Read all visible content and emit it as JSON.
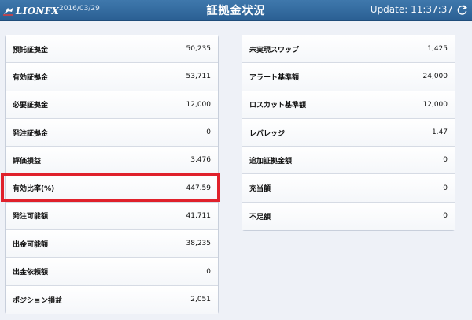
{
  "header": {
    "logo_text": "LIONFX",
    "date": "2016/03/29",
    "title": "証拠金状況",
    "update": "Update: 11:37:37"
  },
  "left_rows": [
    {
      "label": "預託証拠金",
      "value": "50,235"
    },
    {
      "label": "有効証拠金",
      "value": "53,711"
    },
    {
      "label": "必要証拠金",
      "value": "12,000"
    },
    {
      "label": "発注証拠金",
      "value": "0"
    },
    {
      "label": "評価損益",
      "value": "3,476"
    },
    {
      "label": "有効比率(%)",
      "value": "447.59"
    },
    {
      "label": "発注可能額",
      "value": "41,711"
    },
    {
      "label": "出金可能額",
      "value": "38,235"
    },
    {
      "label": "出金依頼額",
      "value": "0"
    },
    {
      "label": "ポジション損益",
      "value": "2,051"
    }
  ],
  "right_rows": [
    {
      "label": "未実現スワップ",
      "value": "1,425"
    },
    {
      "label": "アラート基準額",
      "value": "24,000"
    },
    {
      "label": "ロスカット基準額",
      "value": "12,000"
    },
    {
      "label": "レバレッジ",
      "value": "1.47"
    },
    {
      "label": "追加証拠金額",
      "value": "0"
    },
    {
      "label": "充当額",
      "value": "0"
    },
    {
      "label": "不足額",
      "value": "0"
    }
  ],
  "colors": {
    "header": "#2f6aa0",
    "highlight": "#e0212b"
  },
  "icons": {
    "logo": "lion-icon",
    "refresh": "refresh-icon"
  }
}
